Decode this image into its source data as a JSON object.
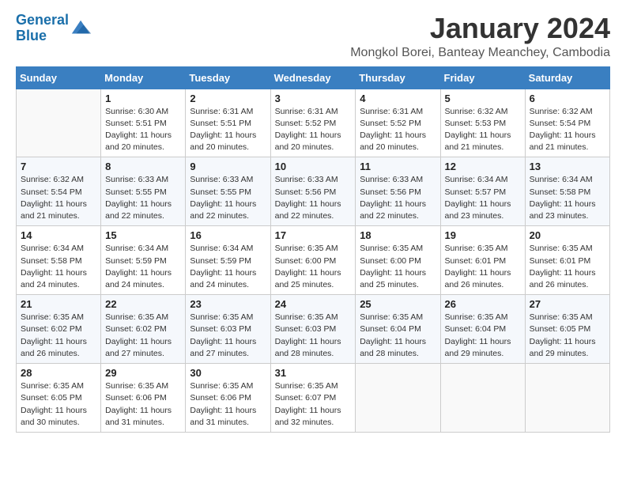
{
  "header": {
    "logo_line1": "General",
    "logo_line2": "Blue",
    "month_title": "January 2024",
    "subtitle": "Mongkol Borei, Banteay Meanchey, Cambodia"
  },
  "weekdays": [
    "Sunday",
    "Monday",
    "Tuesday",
    "Wednesday",
    "Thursday",
    "Friday",
    "Saturday"
  ],
  "weeks": [
    [
      {
        "day": "",
        "info": ""
      },
      {
        "day": "1",
        "info": "Sunrise: 6:30 AM\nSunset: 5:51 PM\nDaylight: 11 hours\nand 20 minutes."
      },
      {
        "day": "2",
        "info": "Sunrise: 6:31 AM\nSunset: 5:51 PM\nDaylight: 11 hours\nand 20 minutes."
      },
      {
        "day": "3",
        "info": "Sunrise: 6:31 AM\nSunset: 5:52 PM\nDaylight: 11 hours\nand 20 minutes."
      },
      {
        "day": "4",
        "info": "Sunrise: 6:31 AM\nSunset: 5:52 PM\nDaylight: 11 hours\nand 20 minutes."
      },
      {
        "day": "5",
        "info": "Sunrise: 6:32 AM\nSunset: 5:53 PM\nDaylight: 11 hours\nand 21 minutes."
      },
      {
        "day": "6",
        "info": "Sunrise: 6:32 AM\nSunset: 5:54 PM\nDaylight: 11 hours\nand 21 minutes."
      }
    ],
    [
      {
        "day": "7",
        "info": "Sunrise: 6:32 AM\nSunset: 5:54 PM\nDaylight: 11 hours\nand 21 minutes."
      },
      {
        "day": "8",
        "info": "Sunrise: 6:33 AM\nSunset: 5:55 PM\nDaylight: 11 hours\nand 22 minutes."
      },
      {
        "day": "9",
        "info": "Sunrise: 6:33 AM\nSunset: 5:55 PM\nDaylight: 11 hours\nand 22 minutes."
      },
      {
        "day": "10",
        "info": "Sunrise: 6:33 AM\nSunset: 5:56 PM\nDaylight: 11 hours\nand 22 minutes."
      },
      {
        "day": "11",
        "info": "Sunrise: 6:33 AM\nSunset: 5:56 PM\nDaylight: 11 hours\nand 22 minutes."
      },
      {
        "day": "12",
        "info": "Sunrise: 6:34 AM\nSunset: 5:57 PM\nDaylight: 11 hours\nand 23 minutes."
      },
      {
        "day": "13",
        "info": "Sunrise: 6:34 AM\nSunset: 5:58 PM\nDaylight: 11 hours\nand 23 minutes."
      }
    ],
    [
      {
        "day": "14",
        "info": "Sunrise: 6:34 AM\nSunset: 5:58 PM\nDaylight: 11 hours\nand 24 minutes."
      },
      {
        "day": "15",
        "info": "Sunrise: 6:34 AM\nSunset: 5:59 PM\nDaylight: 11 hours\nand 24 minutes."
      },
      {
        "day": "16",
        "info": "Sunrise: 6:34 AM\nSunset: 5:59 PM\nDaylight: 11 hours\nand 24 minutes."
      },
      {
        "day": "17",
        "info": "Sunrise: 6:35 AM\nSunset: 6:00 PM\nDaylight: 11 hours\nand 25 minutes."
      },
      {
        "day": "18",
        "info": "Sunrise: 6:35 AM\nSunset: 6:00 PM\nDaylight: 11 hours\nand 25 minutes."
      },
      {
        "day": "19",
        "info": "Sunrise: 6:35 AM\nSunset: 6:01 PM\nDaylight: 11 hours\nand 26 minutes."
      },
      {
        "day": "20",
        "info": "Sunrise: 6:35 AM\nSunset: 6:01 PM\nDaylight: 11 hours\nand 26 minutes."
      }
    ],
    [
      {
        "day": "21",
        "info": "Sunrise: 6:35 AM\nSunset: 6:02 PM\nDaylight: 11 hours\nand 26 minutes."
      },
      {
        "day": "22",
        "info": "Sunrise: 6:35 AM\nSunset: 6:02 PM\nDaylight: 11 hours\nand 27 minutes."
      },
      {
        "day": "23",
        "info": "Sunrise: 6:35 AM\nSunset: 6:03 PM\nDaylight: 11 hours\nand 27 minutes."
      },
      {
        "day": "24",
        "info": "Sunrise: 6:35 AM\nSunset: 6:03 PM\nDaylight: 11 hours\nand 28 minutes."
      },
      {
        "day": "25",
        "info": "Sunrise: 6:35 AM\nSunset: 6:04 PM\nDaylight: 11 hours\nand 28 minutes."
      },
      {
        "day": "26",
        "info": "Sunrise: 6:35 AM\nSunset: 6:04 PM\nDaylight: 11 hours\nand 29 minutes."
      },
      {
        "day": "27",
        "info": "Sunrise: 6:35 AM\nSunset: 6:05 PM\nDaylight: 11 hours\nand 29 minutes."
      }
    ],
    [
      {
        "day": "28",
        "info": "Sunrise: 6:35 AM\nSunset: 6:05 PM\nDaylight: 11 hours\nand 30 minutes."
      },
      {
        "day": "29",
        "info": "Sunrise: 6:35 AM\nSunset: 6:06 PM\nDaylight: 11 hours\nand 31 minutes."
      },
      {
        "day": "30",
        "info": "Sunrise: 6:35 AM\nSunset: 6:06 PM\nDaylight: 11 hours\nand 31 minutes."
      },
      {
        "day": "31",
        "info": "Sunrise: 6:35 AM\nSunset: 6:07 PM\nDaylight: 11 hours\nand 32 minutes."
      },
      {
        "day": "",
        "info": ""
      },
      {
        "day": "",
        "info": ""
      },
      {
        "day": "",
        "info": ""
      }
    ]
  ]
}
